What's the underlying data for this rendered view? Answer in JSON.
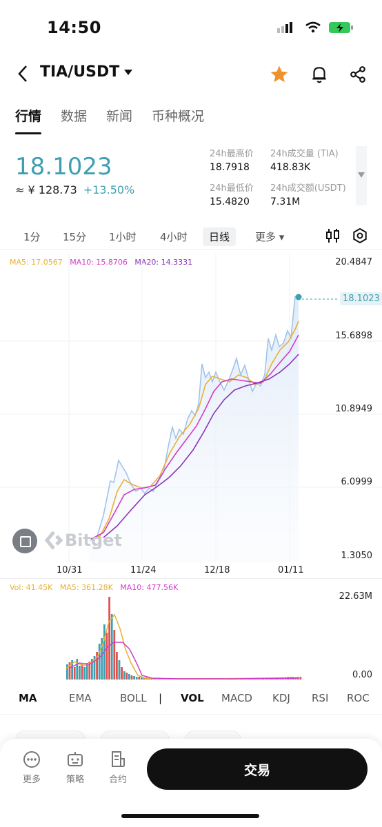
{
  "status": {
    "time": "14:50"
  },
  "header": {
    "pair": "TIA/USDT"
  },
  "tabs": [
    "行情",
    "数据",
    "新闻",
    "币种概况"
  ],
  "ticker": {
    "price": "18.1023",
    "cny": "≈ ¥ 128.73",
    "change": "+13.50%",
    "high_label": "24h最高价",
    "high": "18.7918",
    "low_label": "24h最低价",
    "low": "15.4820",
    "vol_label": "24h成交量 (TIA)",
    "vol": "418.83K",
    "amt_label": "24h成交额(USDT)",
    "amt": "7.31M"
  },
  "timeframes": [
    "1分",
    "15分",
    "1小时",
    "4小时",
    "日线",
    "更多"
  ],
  "ma_legend": {
    "ma5": "MA5: 17.0567",
    "ma10": "MA10: 15.8706",
    "ma20": "MA20: 14.3331"
  },
  "price_axis": [
    "20.4847",
    "15.6898",
    "10.8949",
    "6.0999",
    "1.3050"
  ],
  "last_price_tag": "18.1023",
  "date_axis": [
    "10/31",
    "11/24",
    "12/18",
    "01/11"
  ],
  "watermark": "Bitget",
  "vol_legend": {
    "vol": "Vol: 41.45K",
    "ma5": "MA5: 361.28K",
    "ma10": "MA10: 477.56K"
  },
  "vol_axis": [
    "22.63M",
    "0.00"
  ],
  "indicators": [
    "MA",
    "EMA",
    "BOLL",
    "|",
    "VOL",
    "MACD",
    "KDJ",
    "RSI",
    "ROC"
  ],
  "bottom": {
    "more": "更多",
    "strategy": "策略",
    "contract": "合约",
    "trade": "交易"
  },
  "colors": {
    "accent": "#3e9fb0",
    "star": "#f0922b",
    "up": "#3e9fb0",
    "down": "#e0524d",
    "ma5": "#e8b030",
    "ma10": "#d13cc8",
    "ma20": "#8a33b8",
    "price_line": "#9fc3ec"
  },
  "chart_data": [
    {
      "type": "line",
      "title": "",
      "x": [
        "10/31",
        "11/24",
        "12/18",
        "01/11"
      ],
      "ylim": [
        1.305,
        20.4847
      ],
      "series": [
        {
          "name": "MA5",
          "values": [
            2.2,
            7.0,
            12.5,
            17.0567
          ]
        },
        {
          "name": "MA10",
          "values": [
            2.2,
            6.6,
            12.6,
            15.8706
          ]
        },
        {
          "name": "MA20",
          "values": [
            2.2,
            6.0,
            11.8,
            14.3331
          ]
        }
      ]
    },
    {
      "type": "bar",
      "title": "",
      "ylim": [
        0,
        22.63
      ],
      "series": [
        {
          "name": "Vol",
          "values": [
            0.04
          ]
        }
      ]
    }
  ]
}
